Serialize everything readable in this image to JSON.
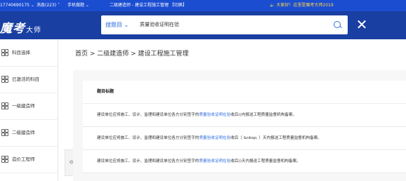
{
  "topbar": {
    "phone": "17740690175 ⌄",
    "messages": "消息(223) ˅",
    "mobile": "手机做题 ⌄",
    "exam": "二级建造师 - 建设工程施工管理 【切换】",
    "greeting": "🔈 大家好！这里是魔考大师2019"
  },
  "header": {
    "logo_text": "魔考",
    "logo_suffix": "大师",
    "search_selector": "搜题目 ⌄",
    "search_query": "质量验收证明在验",
    "close_glyph": "✕"
  },
  "sidebar": {
    "items": [
      {
        "label": "科目选择"
      },
      {
        "label": "已激活的科目"
      },
      {
        "label": "一级建造师"
      },
      {
        "label": "二级建造师"
      },
      {
        "label": "造价工程师"
      }
    ],
    "collapse_glyph": "«"
  },
  "breadcrumb": "首页 > 二级建造师 > 建设工程施工管理",
  "table": {
    "header": "题目标题",
    "rows": [
      {
        "before": "建设单位应将施工、设计、监理和建设单位各方分别签字的",
        "highlight": "质量验收证明在验",
        "after": "收后()内报送工程质量监督机构备案。"
      },
      {
        "before": "建设单位应将施工、设计、监理和建设单位各方分别签字的",
        "highlight": "质量验收证明在验",
        "after": "收后（ &nbsp; ）天内报送工程质量监督机构备案。"
      },
      {
        "before": "建设单位应将施工、设计、监理和建设单位各方分别签字的",
        "highlight": "质量验收证明在验",
        "after": "收后()天内报送工程质量监督机构备案。"
      }
    ]
  }
}
